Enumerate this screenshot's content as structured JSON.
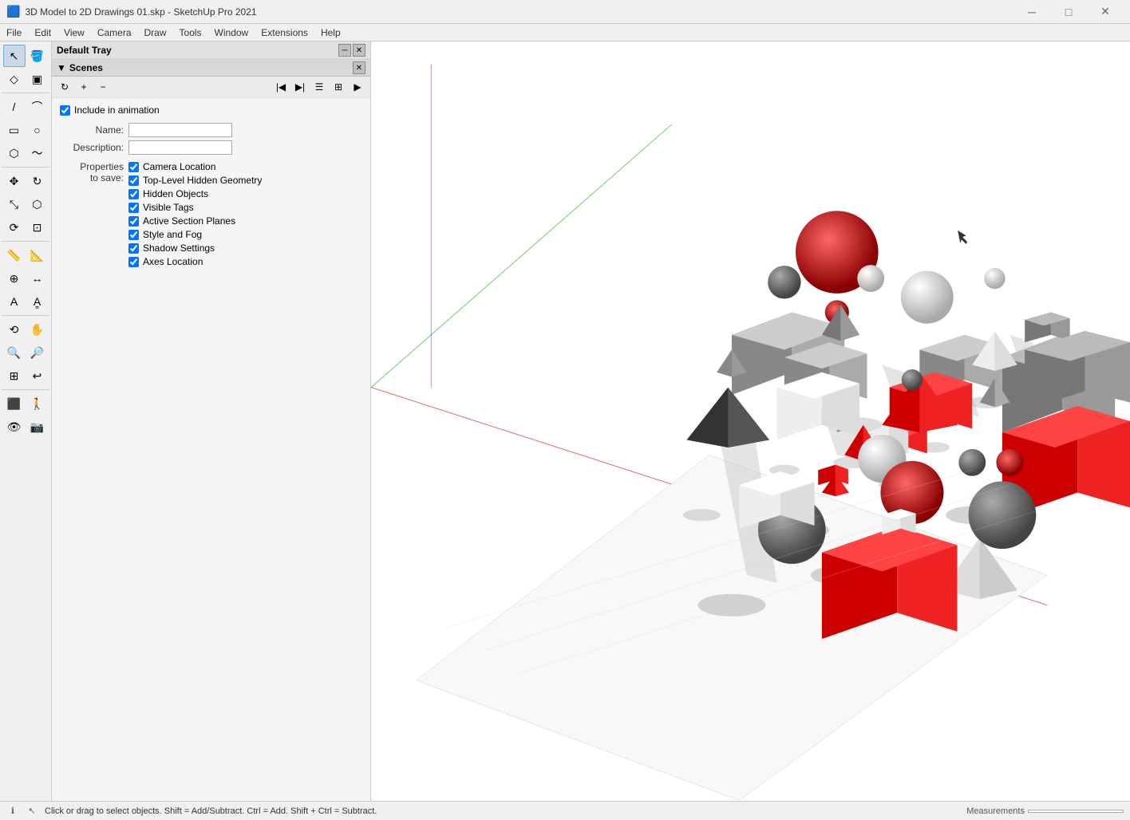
{
  "titlebar": {
    "icon": "🟦",
    "title": "3D Model to 2D Drawings 01.skp - SketchUp Pro 2021",
    "min_label": "─",
    "max_label": "□",
    "close_label": "✕"
  },
  "menubar": {
    "items": [
      "File",
      "Edit",
      "View",
      "Camera",
      "Draw",
      "Tools",
      "Window",
      "Extensions",
      "Help"
    ]
  },
  "tray": {
    "title": "Default Tray",
    "close_label": "✕",
    "pin_label": "─"
  },
  "scenes_panel": {
    "title": "Scenes",
    "close_label": "✕"
  },
  "scenes": {
    "include_animation": true,
    "name_label": "Name:",
    "name_value": "",
    "description_label": "Description:",
    "description_value": "",
    "properties_label": "Properties\nto save:",
    "checkboxes": [
      {
        "id": "camera_location",
        "label": "Camera Location",
        "checked": true
      },
      {
        "id": "top_level_hidden",
        "label": "Top-Level Hidden Geometry",
        "checked": true
      },
      {
        "id": "hidden_objects",
        "label": "Hidden Objects",
        "checked": true
      },
      {
        "id": "visible_tags",
        "label": "Visible Tags",
        "checked": true
      },
      {
        "id": "active_section_planes",
        "label": "Active Section Planes",
        "checked": true
      },
      {
        "id": "style_and_fog",
        "label": "Style and Fog",
        "checked": true
      },
      {
        "id": "shadow_settings",
        "label": "Shadow Settings",
        "checked": true
      },
      {
        "id": "axes_location",
        "label": "Axes Location",
        "checked": true
      }
    ]
  },
  "statusbar": {
    "instruction": "Click or drag to select objects. Shift = Add/Subtract. Ctrl = Add. Shift + Ctrl = Subtract.",
    "measurements_label": "Measurements",
    "info_icon": "ℹ",
    "select_icon": "↖"
  }
}
